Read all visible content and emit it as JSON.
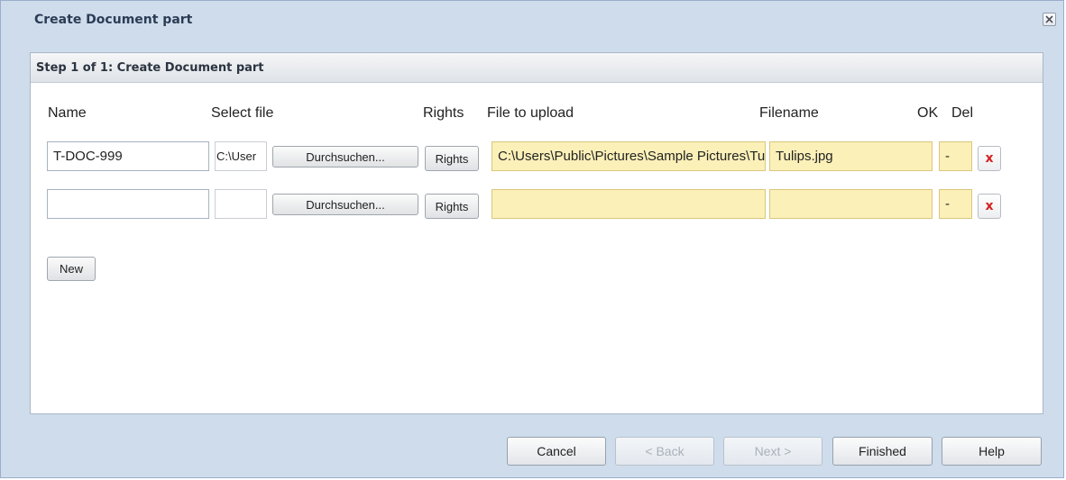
{
  "window": {
    "title": "Create Document part"
  },
  "wizard": {
    "step_title": "Step 1 of 1: Create Document part"
  },
  "columns": {
    "name": "Name",
    "select_file": "Select file",
    "rights": "Rights",
    "file_to_upload": "File to upload",
    "filename": "Filename",
    "ok": "OK",
    "del": "Del"
  },
  "rows": [
    {
      "name_value": "T-DOC-999",
      "select_file_value": "C:\\User",
      "browse_label": "Durchsuchen...",
      "rights_label": "Rights",
      "file_to_upload": "C:\\Users\\Public\\Pictures\\Sample Pictures\\Tulips.jpg",
      "filename": "Tulips.jpg",
      "ok": "-",
      "del_label": "x"
    },
    {
      "name_value": "",
      "select_file_value": "",
      "browse_label": "Durchsuchen...",
      "rights_label": "Rights",
      "file_to_upload": "",
      "filename": "",
      "ok": "-",
      "del_label": "x"
    }
  ],
  "actions": {
    "new_label": "New"
  },
  "footer": {
    "cancel": "Cancel",
    "back": "< Back",
    "next": "Next >",
    "finished": "Finished",
    "help": "Help"
  },
  "colors": {
    "dialog_bg": "#cfdcec",
    "field_yellow": "#fbf0b8",
    "delete_red": "#d42020"
  },
  "icons": {
    "close": "close-icon",
    "delete": "delete-icon"
  }
}
